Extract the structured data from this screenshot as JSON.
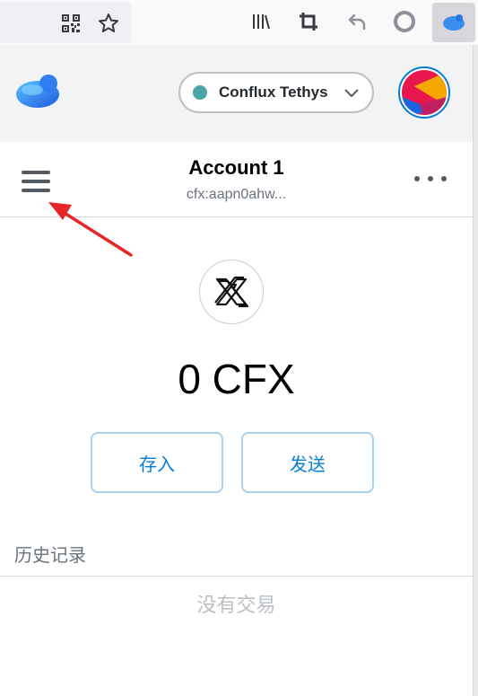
{
  "popup": {
    "network": {
      "name": "Conflux Tethys",
      "dot_color": "#4aa3a4"
    },
    "account": {
      "name": "Account 1",
      "address": "cfx:aapn0ahw..."
    },
    "balance": "0 CFX",
    "buttons": {
      "deposit": "存入",
      "send": "发送"
    },
    "history": {
      "label": "历史记录",
      "empty": "没有交易"
    }
  },
  "colors": {
    "accent": "#037dd6",
    "header_bg": "#f2f3f4",
    "annotation_arrow": "#e8262a"
  },
  "icons": [
    "qr-code-icon",
    "star-icon",
    "library-icon",
    "crop-icon",
    "undo-icon",
    "record-icon",
    "fluent-extension-icon",
    "fluent-logo-icon",
    "chevron-down-icon",
    "hamburger-menu-icon",
    "kebab-menu-icon",
    "cfx-token-icon"
  ]
}
